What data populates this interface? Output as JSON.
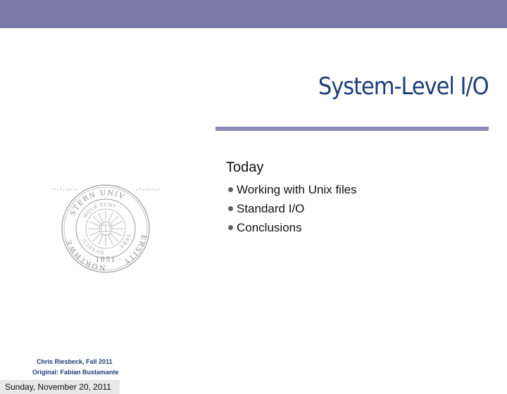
{
  "slide": {
    "title": "System-Level I/O",
    "heading": "Today",
    "bullets": [
      "Working with Unix files",
      "Standard I/O",
      "Conclusions"
    ]
  },
  "seal": {
    "institution": "NORTHWESTERN UNIVERSITY",
    "motto": "QUAECUMQUE SUNT VERA",
    "year": "1851"
  },
  "footer": {
    "author": "Chris Riesbeck, Fall 2011",
    "original": "Original: Fabian Bustamante"
  },
  "date": "Sunday, November 20, 2011",
  "colors": {
    "band": "#7b7aa9",
    "rule": "#8e8cb8",
    "title": "#1d3d78"
  }
}
